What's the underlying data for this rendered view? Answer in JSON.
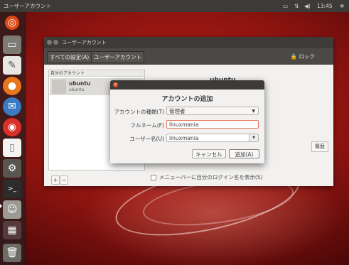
{
  "topbar": {
    "title": "ユーザーアカウント",
    "clock": "13:45",
    "icons": [
      "keyboard-icon",
      "network-icon",
      "volume-icon",
      "gear-icon"
    ]
  },
  "launcher": {
    "items": [
      "dash-icon",
      "files-icon",
      "text-editor-icon",
      "firefox-icon",
      "thunderbird-icon",
      "chromium-icon",
      "document-icon",
      "settings-icon",
      "terminal-icon",
      "user-accounts-icon",
      "workspace-icon",
      "trash-icon"
    ]
  },
  "settings_window": {
    "title": "ユーザーアカウント",
    "nav": {
      "all_settings": "すべての設定(A)",
      "current": "ユーザーアカウント"
    },
    "lock_label": "ロック",
    "account_list": {
      "header": "自分のアカウント",
      "accounts": [
        {
          "name": "ubuntu",
          "sub": "ubuntu"
        }
      ]
    },
    "selected_name": "ubuntu",
    "add_button": "+",
    "remove_button": "−",
    "show_login_name": "メニューバーに自分のログイン名を表示(S)",
    "history_button": "履歴"
  },
  "dialog": {
    "title": "アカウントの追加",
    "account_type_label": "アカウントの種類(T)",
    "account_type_value": "管理者",
    "fullname_label": "フルネーム(F)",
    "fullname_value": "linuxmania",
    "username_label": "ユーザー名(U)",
    "username_value": "linuxmania",
    "cancel_label": "キャンセル",
    "add_label": "追加(A)"
  }
}
